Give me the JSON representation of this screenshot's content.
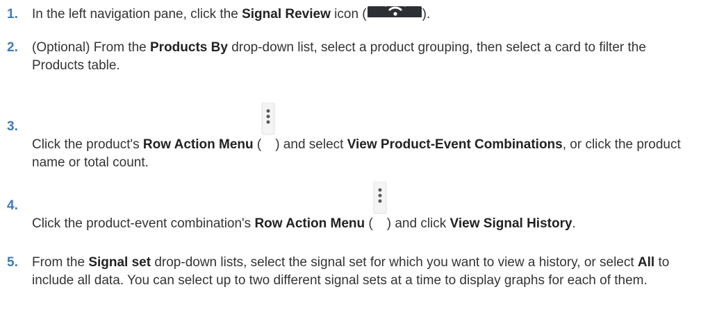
{
  "steps": [
    {
      "number": "1.",
      "parts": {
        "a": "In the left navigation pane, click the ",
        "b": "Signal Review",
        "c": " icon (",
        "d": ")."
      },
      "icon": "wifi-signal-icon"
    },
    {
      "number": "2.",
      "parts": {
        "a": "(Optional) From the ",
        "b": "Products By",
        "c": " drop-down list, select a product grouping, then select a card to filter the Products table."
      }
    },
    {
      "number": "3.",
      "parts": {
        "a": "Click the product's ",
        "b": "Row Action Menu",
        "c": " (",
        "d": ") and select ",
        "e": "View Product-Event Combinations",
        "f": ", or click the product name or total count."
      },
      "icon": "kebab-menu-icon"
    },
    {
      "number": "4.",
      "parts": {
        "a": "Click the product-event combination's ",
        "b": "Row Action Menu",
        "c": " (",
        "d": ") and click ",
        "e": "View Signal History",
        "f": "."
      },
      "icon": "kebab-menu-icon"
    },
    {
      "number": "5.",
      "parts": {
        "a": "From the ",
        "b": "Signal set",
        "c": " drop-down lists, select the signal set for which you want to view a history, or select ",
        "d": "All",
        "e": " to include all data. You can select up to two different signal sets at a time to display graphs for each of them."
      }
    }
  ],
  "colors": {
    "step_number": "#3d7ab8",
    "text": "#333333",
    "icon_tile": "#2c2f33"
  }
}
